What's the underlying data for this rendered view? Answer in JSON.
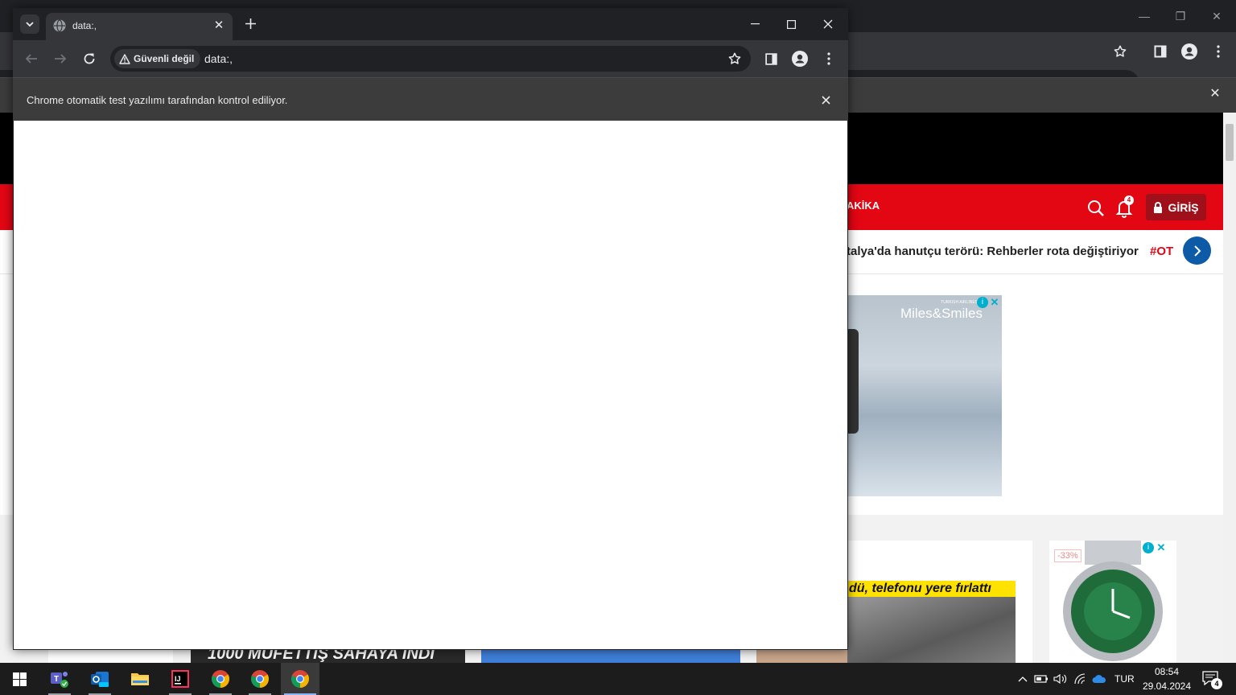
{
  "background_browser": {
    "nav_item_label": "AKİKA",
    "notification_count": "4",
    "login_label": "GİRİŞ",
    "ticker_headline": "talya'da hanutçu terörü: Rehberler rota değiştiriyor",
    "ticker_tag": "#OT",
    "ad_brand_small": "TURKISH AIRLINES",
    "ad_brand": "Miles&Smiles",
    "news_headline": "dü, telefonu yere fırlattı",
    "strip_headline": "1000 MÜFETTİŞ SAHAYA İNDİ",
    "discount_badge": "-33%",
    "brand_color": "#e30613"
  },
  "window": {
    "tab_title": "data:,",
    "security_label": "Güvenli değil",
    "url": "data:,",
    "infobar_text": "Chrome otomatik test yazılımı tarafından kontrol ediliyor.",
    "icons": {
      "tab_search": "chevron-down-icon",
      "favicon": "globe-icon",
      "new_tab": "plus-icon",
      "back": "arrow-left-icon",
      "forward": "arrow-right-icon",
      "reload": "reload-icon",
      "warning": "warning-icon",
      "bookmark": "star-icon",
      "side_panel": "side-panel-icon",
      "profile": "profile-icon",
      "menu": "kebab-menu-icon"
    }
  },
  "taskbar": {
    "apps": [
      "Windows Start",
      "Microsoft Teams",
      "Outlook (new)",
      "File Explorer",
      "IntelliJ IDEA",
      "Google Chrome",
      "Google Chrome",
      "Google Chrome"
    ],
    "language": "TUR",
    "time": "08:54",
    "date": "29.04.2024",
    "notification_count": "4"
  }
}
